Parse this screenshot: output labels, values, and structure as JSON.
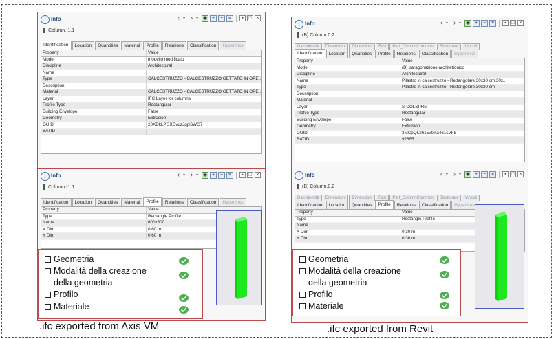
{
  "left": {
    "top_panel": {
      "title": "Info",
      "subtitle": "Column.-1.1",
      "tabs": [
        "Identification",
        "Location",
        "Quantities",
        "Material",
        "Profile",
        "Relations",
        "Classification",
        "Hyperlinks"
      ],
      "active_tab": "Identification",
      "columns": [
        "Property",
        "Value"
      ],
      "rows": [
        [
          "Model",
          "modello modificato"
        ],
        [
          "Discipline",
          "Architectural"
        ],
        [
          "Name",
          ""
        ],
        [
          "Type",
          "CALCESTRUZZO - CALCESTRUZZO GETTATO IN OPE..."
        ],
        [
          "Description",
          ""
        ],
        [
          "Material",
          "CALCESTRUZZO - CALCESTRUZZO GETTATO IN OPE..."
        ],
        [
          "Layer",
          "IFC Layer for columns"
        ],
        [
          "Profile Type",
          "Rectangular"
        ],
        [
          "Building Envelope",
          "False"
        ],
        [
          "Geometry",
          "Extrusion"
        ],
        [
          "GUID",
          "20XDkLPGXCvuzJgpl6WG7"
        ],
        [
          "BATID",
          ""
        ]
      ]
    },
    "bottom_panel": {
      "title": "Info",
      "subtitle": "Column.-1.1",
      "tabs": [
        "Identification",
        "Location",
        "Quantities",
        "Material",
        "Profile",
        "Relations",
        "Classification",
        "Hyperlinks"
      ],
      "active_tab": "Profile",
      "columns": [
        "Property",
        "Value"
      ],
      "rows": [
        [
          "Type",
          "Rectangle Profile"
        ],
        [
          "Name",
          "600x600"
        ],
        [
          "X Dim",
          "0.60 m"
        ],
        [
          "Y Dim",
          "0.60 m"
        ]
      ]
    },
    "checklist": [
      "Geometria",
      "Modalità della creazione",
      "della geometria",
      "Profilo",
      "Materiale"
    ],
    "caption": ".ifc exported from Axis VM"
  },
  "right": {
    "top_panel": {
      "title": "Info",
      "subtitle": "(B) Column.0.2",
      "tabs_top": [
        "Dati identità",
        "Dimensioni",
        "Dimensioni",
        "Fasi",
        "Part_ColumnCommon",
        "Strutturale",
        "Vincoli"
      ],
      "tabs": [
        "Identification",
        "Location",
        "Quantities",
        "Profile",
        "Relations",
        "Classification",
        "Hyperlinks"
      ],
      "active_tab": "Identification",
      "columns": [
        "Property",
        "Value"
      ],
      "rows": [
        [
          "Model",
          "(B) paragonazione architettonico"
        ],
        [
          "Discipline",
          "Architectural"
        ],
        [
          "Name",
          "Pilastro in calcestruzzo - Rettangolare:30x30 cm:30x..."
        ],
        [
          "Type",
          "Pilastro in calcestruzzo - Rettangolare:30x30 cm"
        ],
        [
          "Description",
          ""
        ],
        [
          "Material",
          ""
        ],
        [
          "Layer",
          "S-COLSPRM"
        ],
        [
          "Profile Type",
          "Rectangular"
        ],
        [
          "Building Envelope",
          "False"
        ],
        [
          "Geometry",
          "Extrusion"
        ],
        [
          "GUID",
          "3MCpQL2615vfxka461sVF8"
        ],
        [
          "BATID",
          "92685"
        ]
      ]
    },
    "bottom_panel": {
      "title": "Info",
      "subtitle": "(B) Column.0.2",
      "tabs_top": [
        "Dati identità",
        "Dimensioni",
        "Dimensioni",
        "Fasi",
        "Part_ColumnCommon",
        "Strutturale",
        "Vincoli"
      ],
      "tabs": [
        "Identification",
        "Location",
        "Quantities",
        "Profile",
        "Relations",
        "Classification",
        "Hyperlinks"
      ],
      "active_tab": "Profile",
      "columns": [
        "Property",
        "Value"
      ],
      "rows": [
        [
          "Type",
          "Rectangle Profile"
        ],
        [
          "Name",
          ""
        ],
        [
          "X Dim",
          "0.30 m"
        ],
        [
          "Y Dim",
          "0.30 m"
        ]
      ]
    },
    "checklist": [
      "Geometria",
      "Modalità della creazione",
      "della geometria",
      "Profilo",
      "Materiale"
    ],
    "caption": ".ifc exported from Revit"
  },
  "colors": {
    "panel_border": "#b84a4a",
    "accent": "#3b6fb6",
    "check_green": "#4caf50",
    "column_green": "#1ee81e"
  },
  "icons": [
    "info-icon",
    "back-arrow-icon",
    "forward-arrow-icon",
    "view-icon",
    "expand-icon",
    "collapse-icon",
    "list-icon",
    "window-icon",
    "close-icon",
    "checkmark-icon"
  ]
}
